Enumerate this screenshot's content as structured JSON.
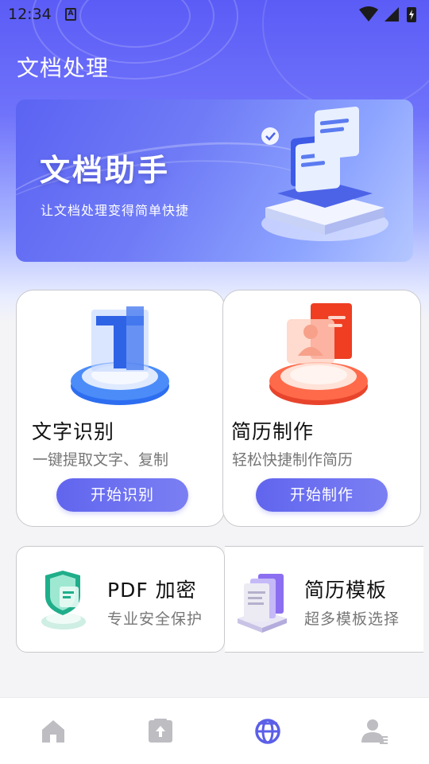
{
  "status_bar": {
    "time": "12:34",
    "notification_glyph": "A",
    "icons": [
      "wifi-icon",
      "signal-icon",
      "battery-charging-icon"
    ]
  },
  "page_title": "文档处理",
  "banner": {
    "title": "文档助手",
    "subtitle": "让文档处理变得简单快捷"
  },
  "features": {
    "ocr": {
      "title": "文字识别",
      "desc": "一键提取文字、复制",
      "button": "开始识别"
    },
    "resume": {
      "title": "简历制作",
      "desc": "轻松快捷制作简历",
      "button": "开始制作"
    },
    "pdf": {
      "title": "PDF 加密",
      "desc": "专业安全保护"
    },
    "template": {
      "title": "简历模板",
      "desc": "超多模板选择"
    }
  },
  "tabbar": {
    "items": [
      {
        "icon": "home-icon",
        "active": false
      },
      {
        "icon": "document-upload-icon",
        "active": false
      },
      {
        "icon": "tools-globe-icon",
        "active": true
      },
      {
        "icon": "profile-icon",
        "active": false
      }
    ]
  },
  "colors": {
    "accent": "#6165ee",
    "tab_active": "#5b5fe8",
    "tab_inactive": "#bdbdc2"
  }
}
